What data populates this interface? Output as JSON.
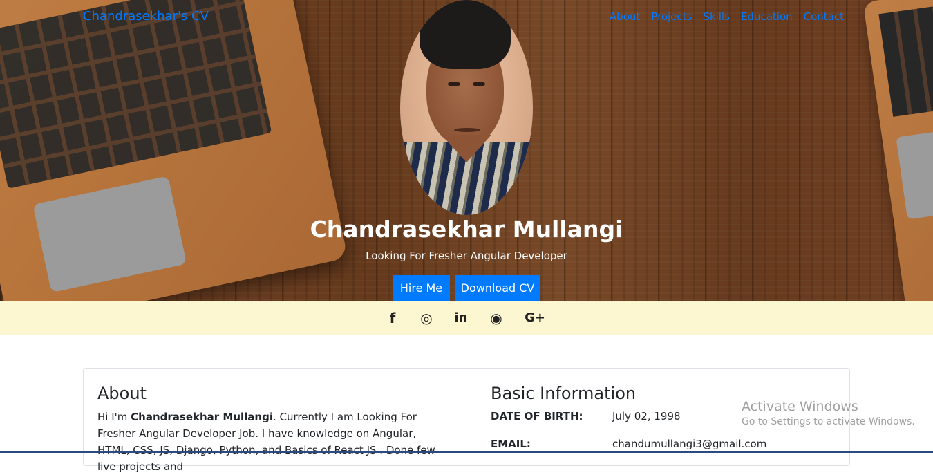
{
  "nav": {
    "brand": "Chandrasekhar's CV",
    "links": [
      "About",
      "Projects",
      "Skills",
      "Education",
      "Contact"
    ]
  },
  "hero": {
    "name": "Chandrasekhar Mullangi",
    "subtitle": "Looking For Fresher Angular Developer",
    "hire_label": "Hire Me",
    "download_label": "Download CV"
  },
  "social": {
    "icons": [
      "facebook-icon",
      "instagram-icon",
      "linkedin-icon",
      "github-icon",
      "google-plus-icon"
    ],
    "glyphs": [
      "f",
      "◎",
      "in",
      "◉",
      "G+"
    ]
  },
  "about": {
    "title": "About",
    "intro": "Hi I'm ",
    "name_bold": "Chandrasekhar Mullangi",
    "text": ". Currently I am Looking For Fresher Angular Developer Job. I have knowledge on Angular, HTML, CSS, JS, Django, Python, and Basics of React JS . Done few live projects and"
  },
  "basic": {
    "title": "Basic Information",
    "rows": [
      {
        "label": "DATE OF BIRTH:",
        "value": "July 02, 1998"
      },
      {
        "label": "EMAIL:",
        "value": "chandumullangi3@gmail.com"
      }
    ]
  },
  "watermark": {
    "title": "Activate Windows",
    "subtitle": "Go to Settings to activate Windows."
  },
  "colors": {
    "accent": "#007bff",
    "social_bar": "#fdf7d1"
  }
}
